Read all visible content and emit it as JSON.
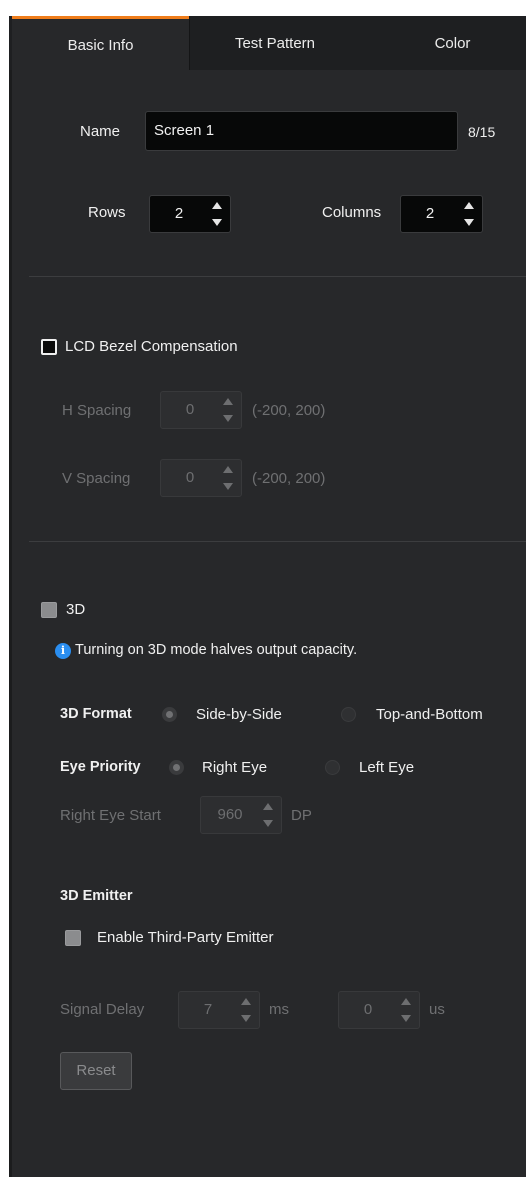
{
  "colors": {
    "accent": "#ef7d1b",
    "panel": "#27282a",
    "tabbar": "#1e1f21",
    "info": "#2a8ef0"
  },
  "tabs": [
    {
      "label": "Basic Info",
      "active": true
    },
    {
      "label": "Test Pattern",
      "active": false
    },
    {
      "label": "Color",
      "active": false
    }
  ],
  "basic": {
    "name_label": "Name",
    "name_value": "Screen 1",
    "name_count": "8/15",
    "rows_label": "Rows",
    "rows_value": "2",
    "columns_label": "Columns",
    "columns_value": "2"
  },
  "bezel": {
    "label": "LCD Bezel Compensation",
    "checked": false,
    "h_label": "H Spacing",
    "h_value": "0",
    "h_range": "(-200, 200)",
    "v_label": "V Spacing",
    "v_value": "0",
    "v_range": "(-200, 200)"
  },
  "three_d": {
    "label": "3D",
    "checked": false,
    "info_text": "Turning on 3D mode halves output capacity.",
    "format_label": "3D Format",
    "format_options": [
      "Side-by-Side",
      "Top-and-Bottom"
    ],
    "format_selected": "Side-by-Side",
    "eye_label": "Eye Priority",
    "eye_options": [
      "Right Eye",
      "Left Eye"
    ],
    "eye_selected": "Right Eye",
    "eye_start_label": "Right Eye Start",
    "eye_start_value": "960",
    "eye_start_unit": "DP"
  },
  "emitter": {
    "heading": "3D Emitter",
    "enable_label": "Enable Third-Party Emitter",
    "enable_checked": false,
    "signal_label": "Signal Delay",
    "ms_value": "7",
    "ms_unit": "ms",
    "us_value": "0",
    "us_unit": "us",
    "reset_label": "Reset"
  }
}
